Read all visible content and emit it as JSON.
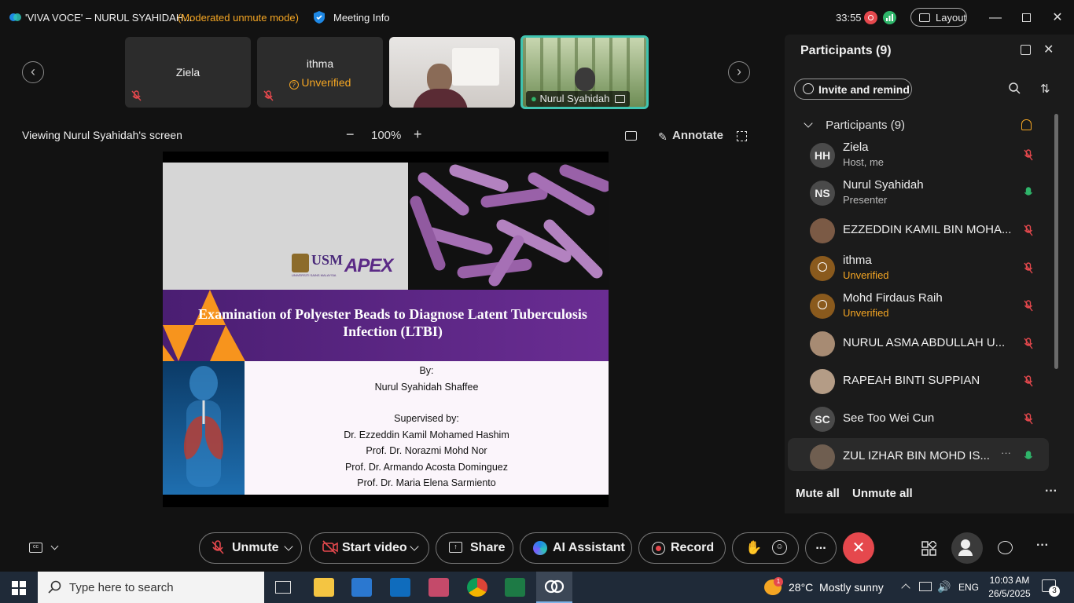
{
  "window": {
    "title": "'VIVA VOCE' – NURUL SYAHIDAH...",
    "mode": "(Moderated unmute mode)",
    "meeting_info": "Meeting Info",
    "timer": "33:55",
    "layout_label": "Layout",
    "colors": {
      "accent": "#f5a623",
      "danger": "#e5484d",
      "ok": "#2fb56a",
      "highlight": "#3fc4b0"
    }
  },
  "thumbnails": [
    {
      "name": "Ziela",
      "status": "",
      "icon": "mic-off-icon"
    },
    {
      "name": "ithma",
      "status": "Unverified",
      "icon": "mic-off-icon"
    },
    {
      "name": "",
      "status": "",
      "icon": "video-feed"
    },
    {
      "name": "Nurul Syahidah",
      "status": "",
      "icon": "mic-on-icon",
      "active": true
    }
  ],
  "share": {
    "viewing_label": "Viewing Nurul Syahidah's screen",
    "zoom": "100%",
    "annotate_label": "Annotate"
  },
  "slide": {
    "title": "Examination of Polyester Beads to Diagnose Latent Tuberculosis Infection (LTBI)",
    "logo_left": "USM",
    "logo_left_sub": "UNIVERSITI SAINS MALAYSIA",
    "logo_right": "APEX",
    "by_label": "By:",
    "author": "Nurul Syahidah Shaffee",
    "supervised_label": "Supervised by:",
    "supervisors": [
      "Dr. Ezzeddin Kamil Mohamed Hashim",
      "Prof. Dr. Norazmi Mohd Nor",
      "Prof. Dr. Armando Acosta Dominguez",
      "Prof. Dr. Maria Elena Sarmiento"
    ]
  },
  "controls": {
    "cc_icon": "cc-icon",
    "unmute": "Unmute",
    "start_video": "Start video",
    "share": "Share",
    "ai_assistant": "AI Assistant",
    "record": "Record",
    "more": "...",
    "end_icon": "close-icon"
  },
  "participants_panel": {
    "title": "Participants (9)",
    "invite_label": "Invite and remind",
    "section_label": "Participants (9)",
    "mute_all": "Mute all",
    "unmute_all": "Unmute all",
    "list": [
      {
        "initials": "HH",
        "name": "Ziela",
        "sub": "Host, me",
        "mic": "muted"
      },
      {
        "initials": "NS",
        "name": "Nurul Syahidah",
        "sub": "Presenter",
        "mic": "on"
      },
      {
        "initials": "",
        "name": "EZZEDDIN KAMIL BIN MOHA...",
        "sub": "",
        "mic": "muted"
      },
      {
        "initials": "",
        "name": "ithma",
        "sub": "Unverified",
        "mic": "muted"
      },
      {
        "initials": "",
        "name": "Mohd Firdaus Raih",
        "sub": "Unverified",
        "mic": "muted"
      },
      {
        "initials": "",
        "name": "NURUL ASMA ABDULLAH U...",
        "sub": "",
        "mic": "muted"
      },
      {
        "initials": "",
        "name": "RAPEAH BINTI SUPPIAN",
        "sub": "",
        "mic": "muted"
      },
      {
        "initials": "SC",
        "name": "See Too Wei Cun",
        "sub": "",
        "mic": "muted"
      },
      {
        "initials": "",
        "name": "ZUL IZHAR BIN MOHD IS...",
        "sub": "",
        "mic": "on"
      }
    ]
  },
  "taskbar": {
    "search_placeholder": "Type here to search",
    "weather": "28°C  Mostly sunny",
    "language": "ENG",
    "time": "10:03 AM",
    "date": "26/5/2025",
    "notif_count": "3",
    "weather_badge": "1"
  }
}
